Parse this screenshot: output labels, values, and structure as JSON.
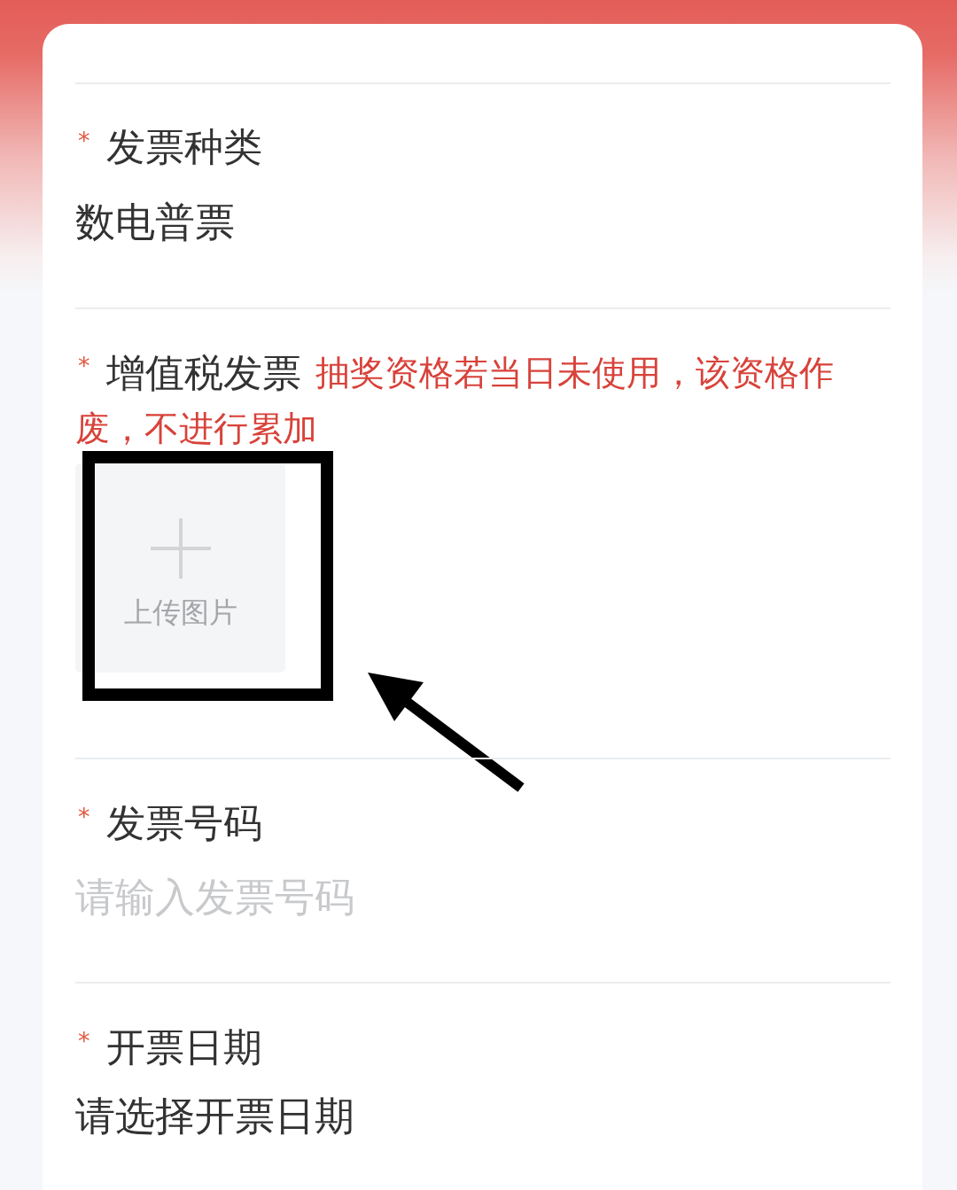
{
  "form": {
    "fields": [
      {
        "kind": "select",
        "required_mark": "*",
        "label": "发票种类",
        "value": "数电普票"
      },
      {
        "kind": "upload",
        "required_mark": "*",
        "label": "增值税发票",
        "hint_lines": [
          "抽奖资格若当日未使用，该资格作",
          "废，不进行累加"
        ],
        "upload_label": "上传图片",
        "highlight_frame": true,
        "pointer_arrow": true
      },
      {
        "kind": "input",
        "required_mark": "*",
        "label": "发票号码",
        "placeholder": "请输入发票号码"
      },
      {
        "kind": "picker",
        "required_mark": "*",
        "label": "开票日期",
        "value": "请选择开票日期"
      }
    ]
  }
}
